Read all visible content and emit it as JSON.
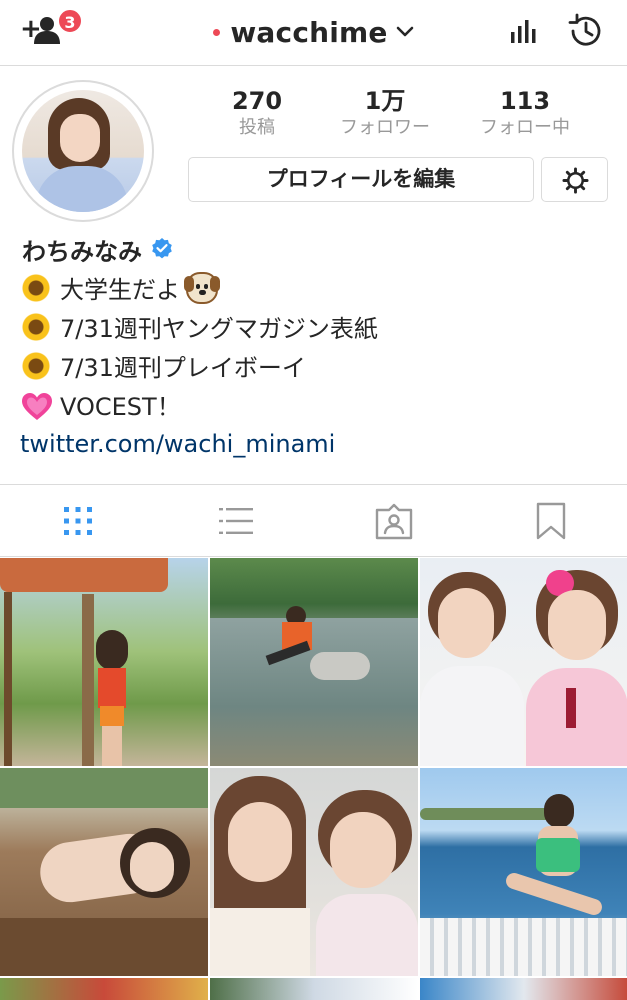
{
  "header": {
    "username": "wacchime",
    "notification_count": "3",
    "icons": [
      "add-user-icon",
      "chevron-down-icon",
      "insights-icon",
      "archive-icon"
    ]
  },
  "profile": {
    "stats": [
      {
        "value": "270",
        "label": "投稿"
      },
      {
        "value": "1万",
        "label": "フォロワー"
      },
      {
        "value": "113",
        "label": "フォロー中"
      }
    ],
    "edit_profile_label": "プロフィールを編集",
    "name": "わちみなみ",
    "verified": true,
    "bio": [
      {
        "icon": "sunflower-icon",
        "text": "大学生だよ",
        "trailing_icon": "dog-face-icon"
      },
      {
        "icon": "sunflower-icon",
        "text": "7/31週刊ヤングマガジン表紙"
      },
      {
        "icon": "sunflower-icon",
        "text": "7/31週刊プレイボーイ"
      },
      {
        "icon": "sparkling-heart-icon",
        "text": "VOCEST！"
      }
    ],
    "link": "twitter.com/wachi_minami"
  },
  "tabs": [
    {
      "name": "grid-view",
      "icon": "grid-icon",
      "active": true
    },
    {
      "name": "list-view",
      "icon": "list-icon",
      "active": false
    },
    {
      "name": "tagged",
      "icon": "tagged-icon",
      "active": false
    },
    {
      "name": "saved",
      "icon": "bookmark-icon",
      "active": false
    }
  ],
  "colors": {
    "accent_blue": "#3897f0",
    "badge_red": "#ed4956",
    "link_blue": "#003569",
    "muted_text": "#999999",
    "divider": "#dbdbdb"
  }
}
